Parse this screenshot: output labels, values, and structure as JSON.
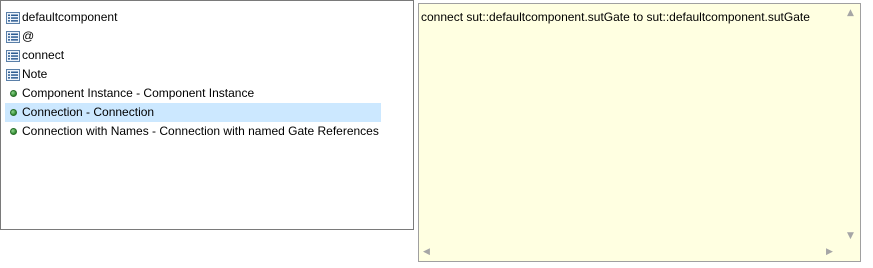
{
  "proposals": [
    {
      "label": "defaultcomponent",
      "icon": "keyword-icon"
    },
    {
      "label": "@",
      "icon": "keyword-icon"
    },
    {
      "label": "connect",
      "icon": "keyword-icon"
    },
    {
      "label": "Note",
      "icon": "keyword-icon"
    },
    {
      "label": "Component Instance - Component Instance",
      "icon": "template-icon"
    },
    {
      "label": "Connection - Connection",
      "icon": "template-icon"
    },
    {
      "label": "Connection with Names - Connection with named Gate References",
      "icon": "template-icon"
    }
  ],
  "selected_index": 5,
  "preview": {
    "text": "connect sut::defaultcomponent.sutGate to sut::defaultcomponent.sutGate"
  },
  "colors": {
    "selection": "#cce8ff",
    "preview_background": "#ffffe1",
    "template_dot": "#2f8a2f"
  }
}
